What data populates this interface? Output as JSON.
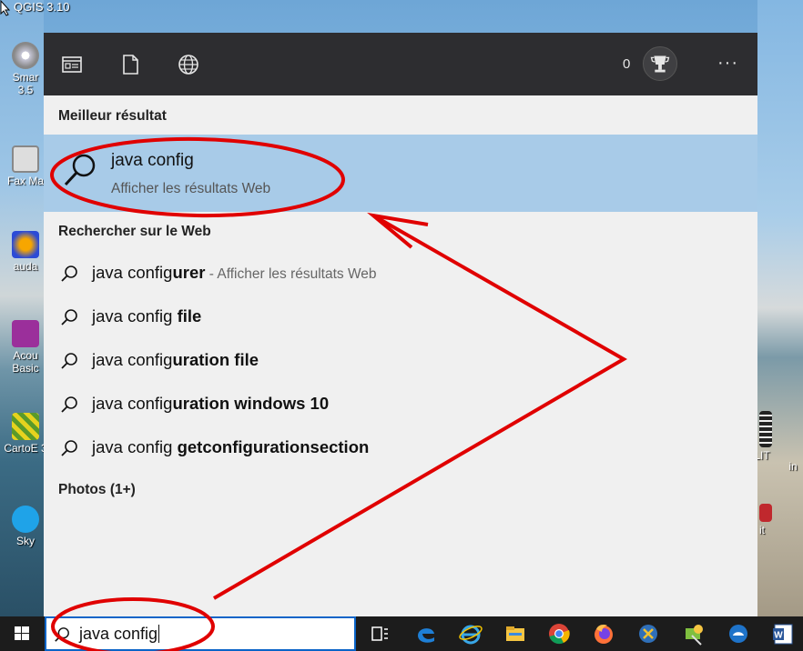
{
  "desktop": {
    "title_label": "QGIS 3.10",
    "icons": [
      {
        "label": "Smar 3.5",
        "icon": "smartboard-icon"
      },
      {
        "label": "Fax Ma",
        "icon": "fax-icon"
      },
      {
        "label": "auda",
        "icon": "audacity-icon"
      },
      {
        "label": "Acou Basic",
        "icon": "acoustic-icon"
      },
      {
        "label": "CartoE 3",
        "icon": "carto-icon"
      },
      {
        "label": "Sky",
        "icon": "skype-icon"
      },
      {
        "label": "LIT",
        "icon": "app-icon"
      },
      {
        "label": "in",
        "icon": "app-icon"
      },
      {
        "label": "it",
        "icon": "app-icon"
      }
    ]
  },
  "panel": {
    "top_icons": [
      "apps-filter-icon",
      "documents-filter-icon",
      "web-filter-icon"
    ],
    "points": "0",
    "more_label": "···",
    "best_result_heading": "Meilleur résultat",
    "best_result": {
      "title": "java config",
      "subtitle": "Afficher les résultats Web"
    },
    "web_heading": "Rechercher sur le Web",
    "suggestions": [
      {
        "prefix": "java config",
        "bold": "urer",
        "hint": " - Afficher les résultats Web"
      },
      {
        "prefix": "java config ",
        "bold": "file",
        "hint": ""
      },
      {
        "prefix": "java config",
        "bold": "uration file",
        "hint": ""
      },
      {
        "prefix": "java config",
        "bold": "uration windows 10",
        "hint": ""
      },
      {
        "prefix": "java config ",
        "bold": "getconfigurationsection",
        "hint": ""
      }
    ],
    "photos_heading": "Photos (1+)"
  },
  "taskbar": {
    "search_query": "java config",
    "apps": [
      "task-view-icon",
      "edge-icon",
      "internet-explorer-icon",
      "file-explorer-icon",
      "chrome-icon",
      "firefox-icon",
      "app-icon",
      "app-icon",
      "outlook-icon",
      "word-icon"
    ]
  },
  "colors": {
    "highlight": "#a8cbe8",
    "annotation": "#e00000",
    "panel_top": "#2d2d30",
    "panel_bg": "#f0f0f0"
  }
}
